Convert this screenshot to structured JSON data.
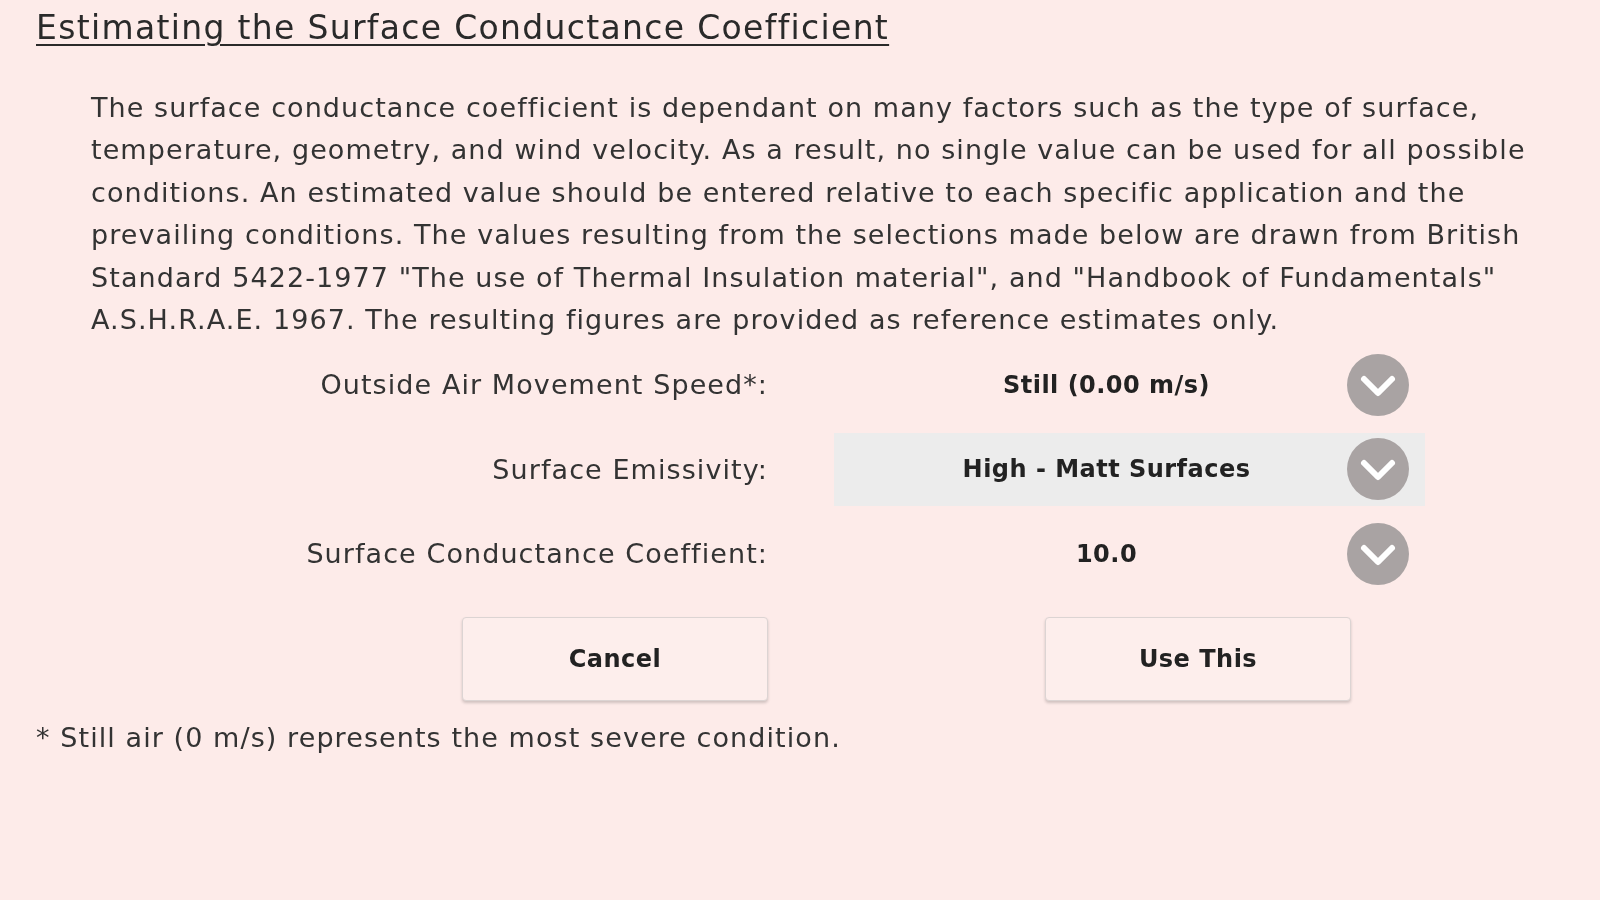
{
  "title": "Estimating the Surface Conductance Coefficient",
  "description": "The surface conductance coefficient is dependant on many factors such as the type of surface, temperature, geometry, and wind velocity. As a result, no single value can be used for all possible conditions. An estimated value should be entered relative to each specific application and the prevailing conditions. The values resulting from the selections made below are drawn from British Standard 5422-1977 \"The use of Thermal Insulation material\", and \"Handbook of Fundamentals\" A.S.H.R.A.E. 1967. The resulting figures are provided as reference estimates only.",
  "fields": [
    {
      "label": "Outside Air Movement Speed*:",
      "value": "Still (0.00 m/s)",
      "selected": false
    },
    {
      "label": "Surface Emissivity:",
      "value": "High - Matt Surfaces",
      "selected": true
    },
    {
      "label": "Surface Conductance Coeffient:",
      "value": "10.0",
      "selected": false
    }
  ],
  "buttons": [
    "Cancel",
    "Use This"
  ],
  "footnote": "* Still air (0 m/s) represents the most severe condition."
}
